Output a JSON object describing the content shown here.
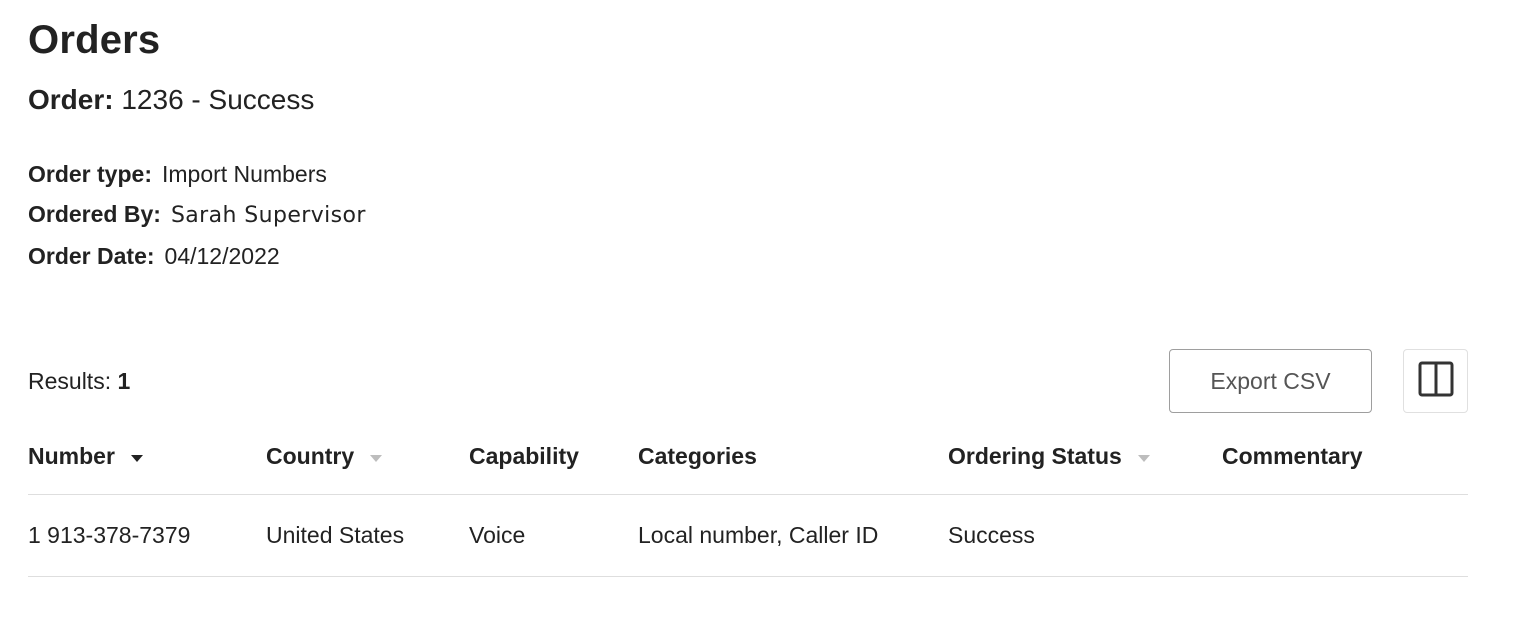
{
  "page": {
    "title": "Orders"
  },
  "order": {
    "label": "Order:",
    "value": "1236 - Success"
  },
  "meta": {
    "order_type_label": "Order type:",
    "order_type_value": "Import Numbers",
    "ordered_by_label": "Ordered By:",
    "ordered_by_value": "Sarah Supervisor",
    "order_date_label": "Order Date:",
    "order_date_value": "04/12/2022"
  },
  "results": {
    "label": "Results:",
    "count": "1"
  },
  "toolbar": {
    "export_label": "Export CSV",
    "columns_icon": "columns-icon"
  },
  "table": {
    "headers": [
      "Number",
      "Country",
      "Capability",
      "Categories",
      "Ordering Status",
      "Commentary"
    ],
    "rows": [
      [
        "1 913-378-7379",
        "United States",
        "Voice",
        "Local number, Caller ID",
        "Success",
        ""
      ]
    ]
  },
  "colors": {
    "text": "#222222",
    "border": "#dedede",
    "button_border": "#9e9e9e",
    "sort_inactive": "#bdbdbd"
  }
}
